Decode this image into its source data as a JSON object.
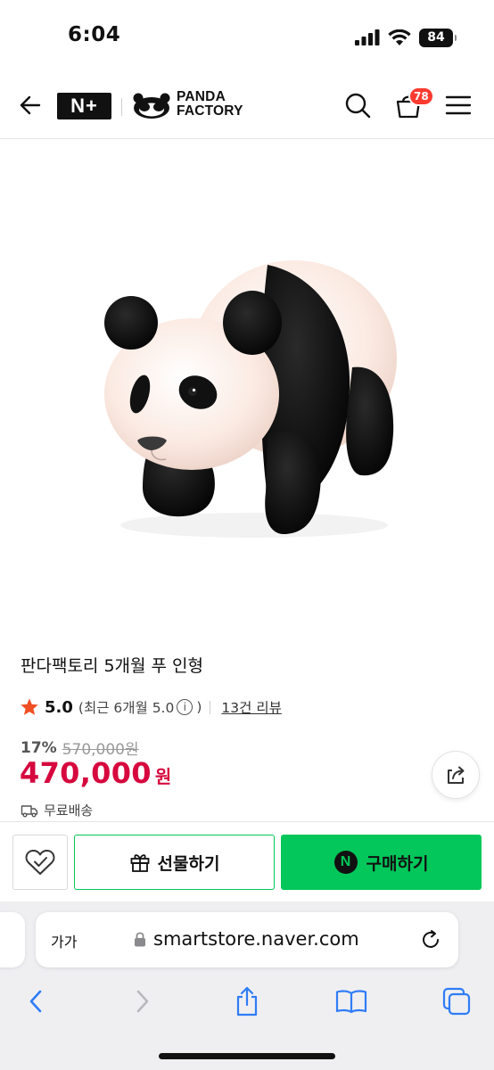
{
  "status_bar": {
    "time": "6:04",
    "battery": "84",
    "icons": [
      "cellular-signal-icon",
      "wifi-icon",
      "battery-icon"
    ]
  },
  "header": {
    "logo_nplus": "N+",
    "brand_line1": "PANDA",
    "brand_line2": "FACTORY",
    "cart_count": "78",
    "icons": [
      "back-arrow-icon",
      "panda-logo-icon",
      "search-icon",
      "cart-icon",
      "menu-icon"
    ]
  },
  "product": {
    "title": "판다팩토리 5개월 푸 인형",
    "rating_score": "5.0",
    "rating_recent_prefix": "(최근 6개월 5.0",
    "rating_recent_suffix": ")",
    "info_glyph": "i",
    "review_link": "13건 리뷰",
    "discount_rate": "17%",
    "original_price": "570,000원",
    "sale_price": "470,000",
    "price_unit": "원",
    "shipping": "무료배송"
  },
  "purchase_bar": {
    "gift_label": "선물하기",
    "buy_label": "구매하기",
    "npay_glyph": "N"
  },
  "browser": {
    "text_size_label": "가가",
    "url": "smartstore.naver.com"
  },
  "colors": {
    "accent_green": "#03c75a",
    "price_red": "#d6083e",
    "badge_red": "#ff3b30",
    "star_orange": "#f04e23"
  }
}
